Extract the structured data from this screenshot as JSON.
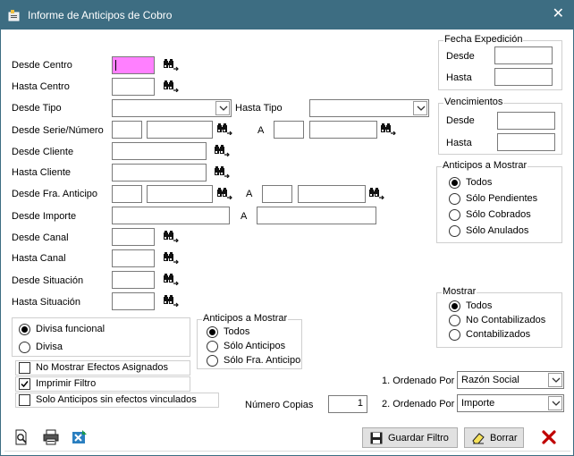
{
  "window": {
    "title": "Informe de Anticipos de Cobro",
    "close_glyph": "✕"
  },
  "form": {
    "desde_centro": "Desde Centro",
    "hasta_centro": "Hasta Centro",
    "desde_tipo": "Desde Tipo",
    "hasta_tipo": "Hasta Tipo",
    "desde_serie": "Desde Serie/Número",
    "a_label": "A",
    "desde_cliente": "Desde Cliente",
    "hasta_cliente": "Hasta Cliente",
    "desde_fra": "Desde Fra. Anticipo",
    "desde_importe": "Desde Importe",
    "desde_canal": "Desde Canal",
    "hasta_canal": "Hasta Canal",
    "desde_situacion": "Desde Situación",
    "hasta_situacion": "Hasta Situación"
  },
  "fecha_expedicion": {
    "title": "Fecha Expedición",
    "desde": "Desde",
    "hasta": "Hasta"
  },
  "vencimientos": {
    "title": "Vencimientos",
    "desde": "Desde",
    "hasta": "Hasta"
  },
  "anticipos_mostrar_right": {
    "title": "Anticipos a Mostrar",
    "options": [
      "Todos",
      "Sólo Pendientes",
      "Sólo Cobrados",
      "Sólo Anulados"
    ],
    "selected": "Todos"
  },
  "mostrar": {
    "title": "Mostrar",
    "options": [
      "Todos",
      "No Contabilizados",
      "Contabilizados"
    ],
    "selected": "Todos"
  },
  "divisa": {
    "options": [
      "Divisa funcional",
      "Divisa"
    ],
    "selected": "Divisa funcional"
  },
  "anticipos_mostrar_center": {
    "title": "Anticipos a Mostrar",
    "options": [
      "Todos",
      "Sólo Anticipos",
      "Sólo Fra. Anticipo"
    ],
    "selected": "Todos"
  },
  "checks": [
    {
      "label": "No Mostrar Efectos Asignados",
      "checked": false
    },
    {
      "label": "Imprimir Filtro",
      "checked": true
    },
    {
      "label": "Solo Anticipos sin efectos vinculados",
      "checked": false
    }
  ],
  "copias": {
    "label": "Número Copias",
    "value": "1"
  },
  "orden": {
    "label1": "1. Ordenado Por",
    "value1": "Razón Social",
    "label2": "2. Ordenado Por",
    "value2": "Importe"
  },
  "buttons": {
    "guardar": "Guardar Filtro",
    "borrar": "Borrar"
  },
  "icons": {
    "title": "window-app-icon",
    "search": "binoculars-icon",
    "preview": "print-preview-icon",
    "print": "printer-icon",
    "excel": "excel-export-icon",
    "save": "floppy-disk-icon",
    "eraser": "eraser-icon",
    "exit": "exit-x-icon"
  },
  "colors": {
    "titlebar": "#3d6d82",
    "focused_field": "#ff80ff",
    "exit_icon": "#c00000"
  }
}
